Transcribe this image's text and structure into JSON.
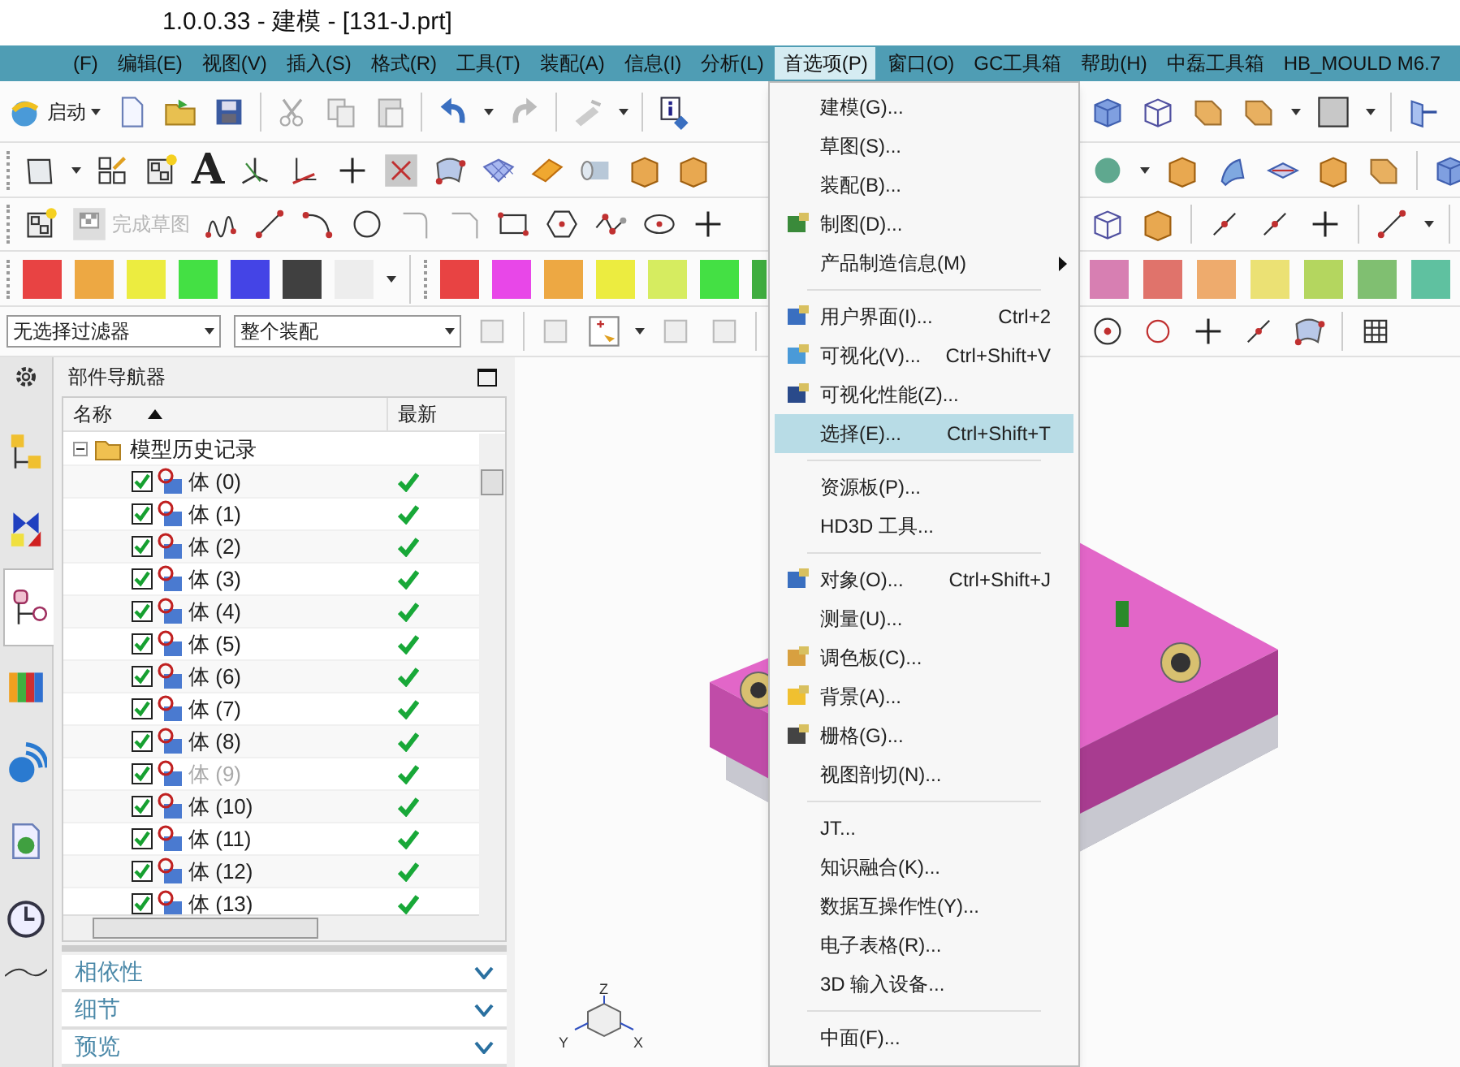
{
  "window": {
    "title": "1.0.0.33 - 建模 - [131-J.prt]"
  },
  "menu_bar": [
    {
      "label": "(F)",
      "selected": false
    },
    {
      "label": "编辑(E)",
      "selected": false
    },
    {
      "label": "视图(V)",
      "selected": false
    },
    {
      "label": "插入(S)",
      "selected": false
    },
    {
      "label": "格式(R)",
      "selected": false
    },
    {
      "label": "工具(T)",
      "selected": false
    },
    {
      "label": "装配(A)",
      "selected": false
    },
    {
      "label": "信息(I)",
      "selected": false
    },
    {
      "label": "分析(L)",
      "selected": false
    },
    {
      "label": "首选项(P)",
      "selected": true
    },
    {
      "label": "窗口(O)",
      "selected": false
    },
    {
      "label": "GC工具箱",
      "selected": false
    },
    {
      "label": "帮助(H)",
      "selected": false
    },
    {
      "label": "中磊工具箱",
      "selected": false
    },
    {
      "label": "HB_MOULD M6.7",
      "selected": false
    }
  ],
  "toolbar": {
    "start_button": "启动",
    "text_tool_glyph": "A",
    "finish_sketch": {
      "label": "完成草图",
      "disabled": true
    },
    "selection_filter": "无选择过滤器",
    "selection_scope": "整个装配"
  },
  "palette_left": [
    {
      "color": "#e84343"
    },
    {
      "color": "#eda843"
    },
    {
      "color": "#ecec40"
    },
    {
      "color": "#44e044"
    },
    {
      "color": "#4444e6"
    },
    {
      "color": "#404040"
    },
    {
      "color": "#ededed"
    }
  ],
  "palette_middle": [
    {
      "color": "#e84343"
    },
    {
      "color": "#e847e8"
    },
    {
      "color": "#eda843"
    },
    {
      "color": "#ecec40"
    },
    {
      "color": "#d6ec60"
    },
    {
      "color": "#44e044"
    },
    {
      "color": "#40ad40"
    }
  ],
  "palette_right": [
    {
      "color": "#d77fb2"
    },
    {
      "color": "#e0736b"
    },
    {
      "color": "#eeab6d"
    },
    {
      "color": "#ebe174"
    },
    {
      "color": "#b4d65f"
    },
    {
      "color": "#80bf71"
    },
    {
      "color": "#5fc1a0"
    }
  ],
  "side_tabs": [
    {
      "selected": false
    },
    {
      "selected": false
    },
    {
      "selected": true
    },
    {
      "selected": false
    },
    {
      "selected": false
    },
    {
      "selected": false
    },
    {
      "selected": false
    }
  ],
  "part_navigator": {
    "title": "部件导航器",
    "columns": [
      "名称",
      "最新"
    ],
    "tree": {
      "label": "模型历史记录",
      "expanded": true,
      "children": [
        {
          "label": "体 (0)",
          "checked": true,
          "dimmed": false,
          "up_to_date": true
        },
        {
          "label": "体 (1)",
          "checked": true,
          "dimmed": false,
          "up_to_date": true
        },
        {
          "label": "体 (2)",
          "checked": true,
          "dimmed": false,
          "up_to_date": true
        },
        {
          "label": "体 (3)",
          "checked": true,
          "dimmed": false,
          "up_to_date": true
        },
        {
          "label": "体 (4)",
          "checked": true,
          "dimmed": false,
          "up_to_date": true
        },
        {
          "label": "体 (5)",
          "checked": true,
          "dimmed": false,
          "up_to_date": true
        },
        {
          "label": "体 (6)",
          "checked": true,
          "dimmed": false,
          "up_to_date": true
        },
        {
          "label": "体 (7)",
          "checked": true,
          "dimmed": false,
          "up_to_date": true
        },
        {
          "label": "体 (8)",
          "checked": true,
          "dimmed": false,
          "up_to_date": true
        },
        {
          "label": "体 (9)",
          "checked": true,
          "dimmed": true,
          "up_to_date": true
        },
        {
          "label": "体 (10)",
          "checked": true,
          "dimmed": false,
          "up_to_date": true
        },
        {
          "label": "体 (11)",
          "checked": true,
          "dimmed": false,
          "up_to_date": true
        },
        {
          "label": "体 (12)",
          "checked": true,
          "dimmed": false,
          "up_to_date": true
        },
        {
          "label": "体 (13)",
          "checked": true,
          "dimmed": false,
          "up_to_date": true
        }
      ]
    },
    "panels": [
      {
        "label": "相依性",
        "expanded": false
      },
      {
        "label": "细节",
        "expanded": false
      },
      {
        "label": "预览",
        "expanded": false
      }
    ]
  },
  "triad_labels": [
    "Z",
    "Y",
    "X"
  ],
  "dropdown_menu": [
    {
      "kind": "item",
      "label": "建模(G)...",
      "has_icon": false,
      "selected": false
    },
    {
      "kind": "item",
      "label": "草图(S)...",
      "has_icon": false,
      "selected": false
    },
    {
      "kind": "item",
      "label": "装配(B)...",
      "has_icon": false,
      "selected": false
    },
    {
      "kind": "item",
      "label": "制图(D)...",
      "has_icon": true,
      "selected": false
    },
    {
      "kind": "item",
      "label": "产品制造信息(M)",
      "has_icon": false,
      "has_submenu": true,
      "selected": false
    },
    {
      "kind": "separator"
    },
    {
      "kind": "item",
      "label": "用户界面(I)...",
      "shortcut": "Ctrl+2",
      "has_icon": true,
      "selected": false
    },
    {
      "kind": "item",
      "label": "可视化(V)...",
      "shortcut": "Ctrl+Shift+V",
      "has_icon": true,
      "selected": false
    },
    {
      "kind": "item",
      "label": "可视化性能(Z)...",
      "has_icon": true,
      "selected": false
    },
    {
      "kind": "item",
      "label": "选择(E)...",
      "shortcut": "Ctrl+Shift+T",
      "has_icon": false,
      "selected": true
    },
    {
      "kind": "separator"
    },
    {
      "kind": "item",
      "label": "资源板(P)...",
      "has_icon": false,
      "selected": false
    },
    {
      "kind": "item",
      "label": "HD3D 工具...",
      "has_icon": false,
      "selected": false
    },
    {
      "kind": "separator"
    },
    {
      "kind": "item",
      "label": "对象(O)...",
      "shortcut": "Ctrl+Shift+J",
      "has_icon": true,
      "selected": false
    },
    {
      "kind": "item",
      "label": "测量(U)...",
      "has_icon": false,
      "selected": false
    },
    {
      "kind": "item",
      "label": "调色板(C)...",
      "has_icon": true,
      "selected": false
    },
    {
      "kind": "item",
      "label": "背景(A)...",
      "has_icon": true,
      "selected": false
    },
    {
      "kind": "item",
      "label": "栅格(G)...",
      "has_icon": true,
      "selected": false
    },
    {
      "kind": "item",
      "label": "视图剖切(N)...",
      "has_icon": false,
      "selected": false
    },
    {
      "kind": "separator"
    },
    {
      "kind": "item",
      "label": "JT...",
      "has_icon": false,
      "selected": false
    },
    {
      "kind": "item",
      "label": "知识融合(K)...",
      "has_icon": false,
      "selected": false
    },
    {
      "kind": "item",
      "label": "数据互操作性(Y)...",
      "has_icon": false,
      "selected": false
    },
    {
      "kind": "item",
      "label": "电子表格(R)...",
      "has_icon": false,
      "selected": false
    },
    {
      "kind": "item",
      "label": "3D 输入设备...",
      "has_icon": false,
      "selected": false
    },
    {
      "kind": "separator"
    },
    {
      "kind": "item",
      "label": "中面(F)...",
      "has_icon": false,
      "selected": false
    }
  ]
}
